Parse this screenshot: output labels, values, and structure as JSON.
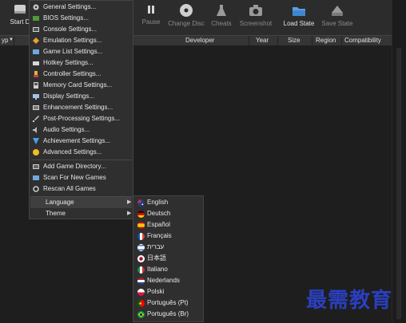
{
  "toolbar": {
    "start_partial": "Start D",
    "pause": "Pause",
    "change_disc": "Change Disc",
    "cheats": "Cheats",
    "screenshot": "Screenshot",
    "load_state": "Load State",
    "save_state": "Save State"
  },
  "columns": {
    "type": "yp",
    "developer": "Developer",
    "year": "Year",
    "size": "Size",
    "region": "Region",
    "compatibility": "Compatibility"
  },
  "settings_menu": {
    "items": [
      {
        "label": "General Settings...",
        "icon": "gear-icon"
      },
      {
        "label": "BIOS Settings...",
        "icon": "chip-icon"
      },
      {
        "label": "Console Settings...",
        "icon": "console-icon"
      },
      {
        "label": "Emulation Settings...",
        "icon": "diamond-icon"
      },
      {
        "label": "Game List Settings...",
        "icon": "folder-icon"
      },
      {
        "label": "Hotkey Settings...",
        "icon": "keyboard-icon"
      },
      {
        "label": "Controller Settings...",
        "icon": "gamepad-icon"
      },
      {
        "label": "Memory Card Settings...",
        "icon": "memory-card-icon"
      },
      {
        "label": "Display Settings...",
        "icon": "monitor-icon"
      },
      {
        "label": "Enhancement Settings...",
        "icon": "enhancement-icon"
      },
      {
        "label": "Post-Processing Settings...",
        "icon": "brush-icon"
      },
      {
        "label": "Audio Settings...",
        "icon": "speaker-icon"
      },
      {
        "label": "Achievement Settings...",
        "icon": "trophy-icon"
      },
      {
        "label": "Advanced Settings...",
        "icon": "warning-icon"
      }
    ],
    "items2": [
      {
        "label": "Add Game Directory...",
        "icon": "add-folder-icon"
      },
      {
        "label": "Scan For New Games",
        "icon": "scan-icon"
      },
      {
        "label": "Rescan All Games",
        "icon": "refresh-icon"
      }
    ],
    "language": "Language",
    "theme": "Theme"
  },
  "languages": [
    {
      "label": "English",
      "flag": "australia-flag-icon"
    },
    {
      "label": "Deutsch",
      "flag": "germany-flag-icon"
    },
    {
      "label": "Español",
      "flag": "spain-flag-icon"
    },
    {
      "label": "Français",
      "flag": "france-flag-icon"
    },
    {
      "label": "עברית",
      "flag": "israel-flag-icon"
    },
    {
      "label": "日本語",
      "flag": "japan-flag-icon"
    },
    {
      "label": "Italiano",
      "flag": "italy-flag-icon"
    },
    {
      "label": "Nederlands",
      "flag": "netherlands-flag-icon"
    },
    {
      "label": "Polski",
      "flag": "poland-flag-icon"
    },
    {
      "label": "Português (Pt)",
      "flag": "portugal-flag-icon"
    },
    {
      "label": "Português (Br)",
      "flag": "brazil-flag-icon"
    }
  ],
  "watermark": "最需教育"
}
